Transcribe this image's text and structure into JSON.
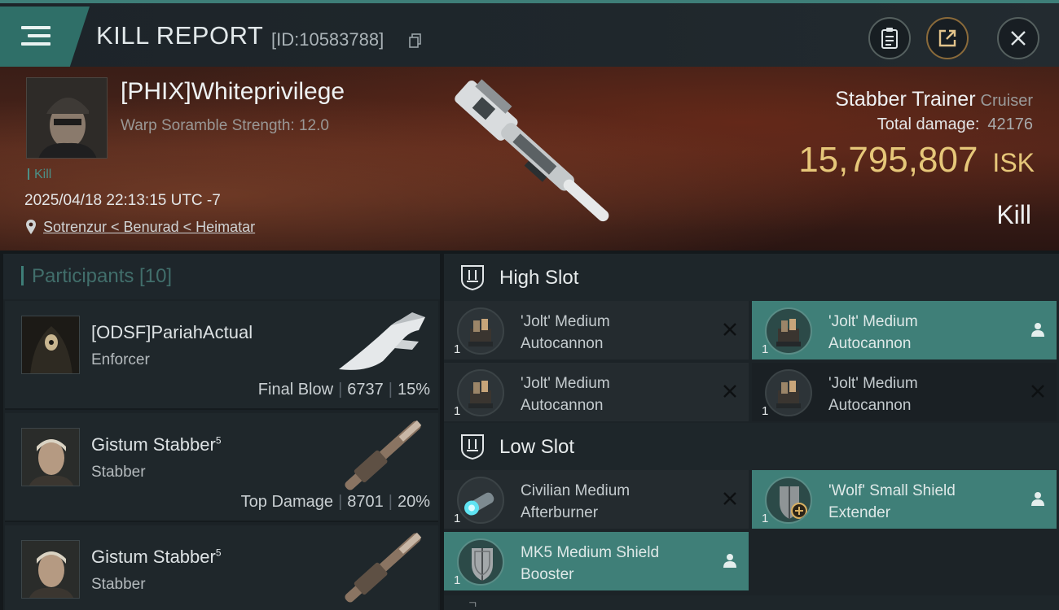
{
  "header": {
    "title": "KILL REPORT",
    "report_id": "[ID:10583788]"
  },
  "victim": {
    "name": "[PHIX]Whiteprivilege",
    "detail": "Warp Soramble Strength: 12.0",
    "kill_tag": "Kill",
    "datetime": "2025/04/18 22:13:15 UTC -7",
    "location": "Sotrenzur < Benurad < Heimatar",
    "ship_name": "Stabber Trainer",
    "ship_class": "Cruiser",
    "damage_label": "Total damage:",
    "damage_value": "42176",
    "isk_amount": "15,795,807",
    "isk_unit": "ISK",
    "result": "Kill"
  },
  "participants": {
    "header": "Participants [10]",
    "items": [
      {
        "name": "[ODSF]PariahActual",
        "sup": "",
        "ship": "Enforcer",
        "role": "Final Blow",
        "damage": "6737",
        "percent": "15%"
      },
      {
        "name": "Gistum Stabber",
        "sup": "5",
        "ship": "Stabber",
        "role": "Top Damage",
        "damage": "8701",
        "percent": "20%"
      },
      {
        "name": "Gistum Stabber",
        "sup": "5",
        "ship": "Stabber",
        "role": "",
        "damage": "",
        "percent": ""
      }
    ]
  },
  "slots": {
    "high": {
      "label": "High Slot",
      "modules": [
        {
          "name_1": "'Jolt' Medium",
          "name_2": "Autocannon",
          "qty": "1",
          "action_icon": "close-icon"
        },
        {
          "name_1": "'Jolt' Medium",
          "name_2": "Autocannon",
          "qty": "1",
          "action_icon": "person-icon"
        },
        {
          "name_1": "'Jolt' Medium",
          "name_2": "Autocannon",
          "qty": "1",
          "action_icon": "close-icon"
        },
        {
          "name_1": "'Jolt' Medium",
          "name_2": "Autocannon",
          "qty": "1",
          "action_icon": "close-icon"
        }
      ]
    },
    "low": {
      "label": "Low Slot",
      "modules": [
        {
          "name_1": "Civilian Medium",
          "name_2": "Afterburner",
          "qty": "1",
          "action_icon": "close-icon"
        },
        {
          "name_1": "'Wolf' Small Shield",
          "name_2": "Extender",
          "qty": "1",
          "action_icon": "person-icon"
        },
        {
          "name_1": "MK5 Medium Shield",
          "name_2": "Booster",
          "qty": "1",
          "action_icon": "person-icon"
        }
      ]
    }
  },
  "colors": {
    "accent_teal": "#3f7f78",
    "isk_gold": "#e6c779",
    "banner_red": "#4b241a"
  }
}
